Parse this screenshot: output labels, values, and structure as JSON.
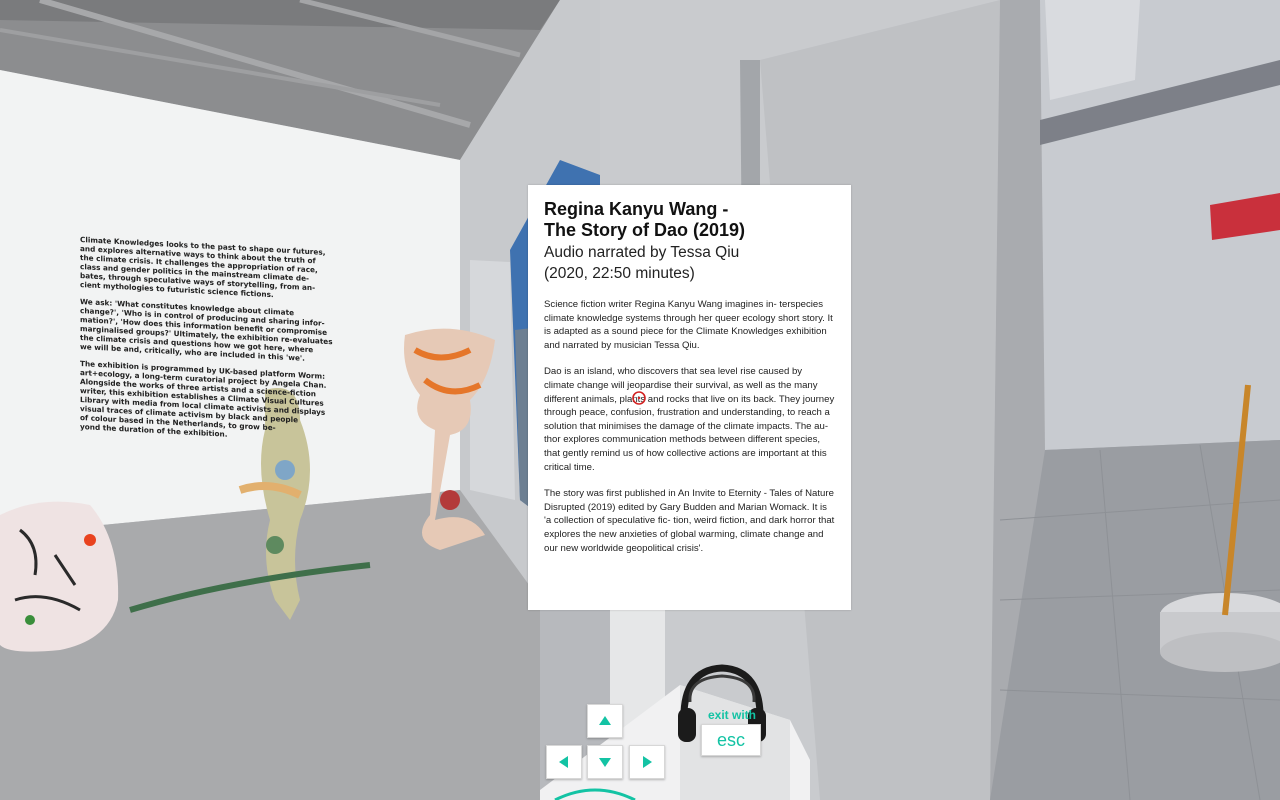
{
  "wall_text": {
    "paragraphs": [
      "Climate Knowledges looks to the past to shape our futures,\nand explores alternative ways to think about the truth of\nthe climate crisis. It challenges the appropriation of race,\nclass and gender politics in the mainstream climate de-\nbates, through speculative ways of storytelling, from an-\ncient mythologies to futuristic science fictions.",
      "We ask: 'What constitutes knowledge about climate\nchange?', 'Who is in control of producing and sharing infor-\nmation?', 'How does this information benefit or compromise\nmarginalised groups?' Ultimately, the exhibition re-evaluates\nthe climate crisis and questions how we got here, where\nwe will be and, critically, who are included in this 'we'.",
      "The exhibition is programmed by UK-based platform Worm:\nart+ecology, a long-term curatorial project by Angela Chan.\nAlongside the works of three artists and a science-fiction\nwriter, this exhibition establishes a Climate Visual Cultures\nLibrary with media from local climate activists and displays\nvisual traces of climate activism by black and people\nof colour based in the Netherlands, to grow be-\nyond the duration of the exhibition."
    ]
  },
  "info_panel": {
    "title_line1": "Regina Kanyu Wang -",
    "title_line2": "The Story of Dao (2019)",
    "subtitle_line1": "Audio narrated by Tessa Qiu",
    "subtitle_line2": "(2020, 22:50 minutes)",
    "paragraphs": [
      "Science fiction writer Regina Kanyu Wang imagines in- terspecies climate knowledge systems through her queer ecology short story. It is adapted as a sound piece for the Climate Knowledges exhibition and narrated by musician Tessa Qiu.",
      "Dao is an island, who discovers that sea level rise caused by climate change will jeopardise their survival, as well as the many different animals, plants and rocks that live on its back. They journey through peace, confusion, frustration and understanding, to reach a solution that minimises the damage of the climate impacts. The au- thor explores communication methods between different species, that gently remind us of how collective actions are important at this critical time.",
      "The story was first published in An Invite to Eternity - Tales of Nature Disrupted (2019) edited by Gary Budden and Marian Womack. It is 'a collection of speculative fic- tion, weird fiction, and dark horror that explores the new anxieties of global warming, climate change and our new worldwide geopolitical crisis'."
    ]
  },
  "controls": {
    "icons": [
      "arrow-up-icon",
      "arrow-left-icon",
      "arrow-down-icon",
      "arrow-right-icon"
    ],
    "exit_label": "exit with",
    "esc_label": "esc"
  },
  "colors": {
    "accent": "#13c3a4",
    "crosshair": "#d22222"
  }
}
